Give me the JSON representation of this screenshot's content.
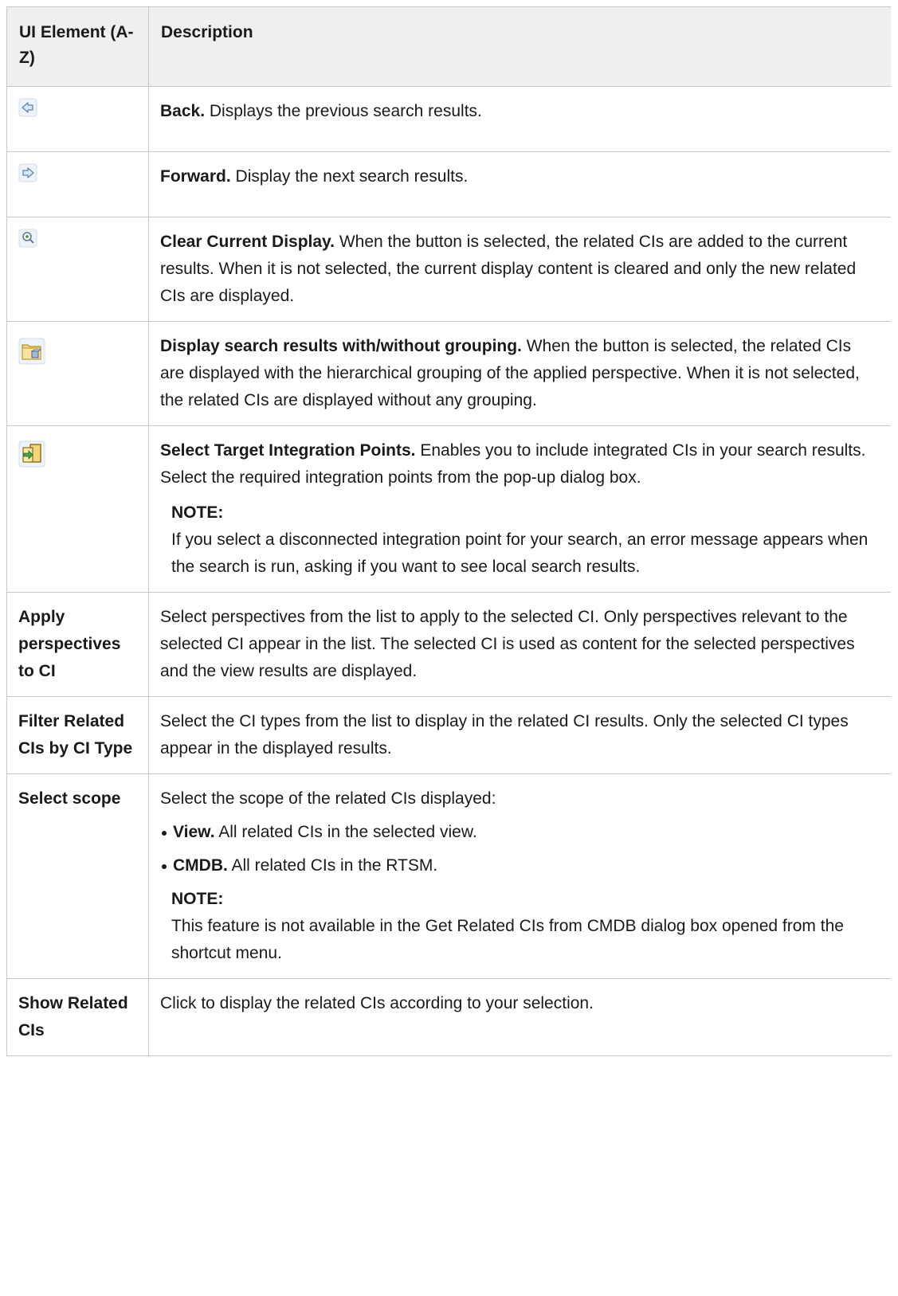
{
  "header": {
    "col_element": "UI Element (A-Z)",
    "col_description": "Description"
  },
  "rows": [
    {
      "icon": "back-arrow-icon",
      "lead": "Back.",
      "text": " Displays the previous search results."
    },
    {
      "icon": "forward-arrow-icon",
      "lead": "Forward.",
      "text": " Display the next search results."
    },
    {
      "icon": "clear-display-icon",
      "lead": "Clear Current Display.",
      "text": " When the button is selected, the related CIs are added to the current results. When it is not selected, the current display content is cleared and only the new related CIs are displayed."
    },
    {
      "icon": "grouping-folder-icon",
      "lead": "Display search results with/without grouping.",
      "text": " When the button is selected, the related CIs are displayed with the hierarchical grouping of the applied perspective. When it is not selected, the related CIs are displayed without any grouping."
    },
    {
      "icon": "integration-points-icon",
      "lead": "Select Target Integration Points.",
      "text": " Enables you to include integrated CIs in your search results. Select the required integration points from the pop-up dialog box.",
      "note_title": "NOTE:",
      "note_text": "If you select a disconnected integration point for your search, an error message appears when the search is run, asking if you want to see local search results."
    },
    {
      "element": "Apply perspectives to CI",
      "text": "Select perspectives from the list to apply to the selected CI. Only perspectives relevant to the selected CI appear in the list. The selected CI is used as content for the selected perspectives and the view results are displayed."
    },
    {
      "element": "Filter Related CIs by CI Type",
      "text": "Select the CI types from the list to display in the related CI results. Only the selected CI types appear in the displayed results."
    },
    {
      "element": "Select scope",
      "text": "Select the scope of the related CIs displayed:",
      "bullets": [
        {
          "lead": "View.",
          "text": " All related CIs in the selected view."
        },
        {
          "lead": "CMDB.",
          "text": " All related CIs in the RTSM."
        }
      ],
      "note_title": "NOTE:",
      "note_text": "This feature is not available in the Get Related CIs from CMDB dialog box opened from the shortcut menu."
    },
    {
      "element": "Show Related CIs",
      "text": "Click to display the related CIs according to your selection."
    }
  ],
  "colors": {
    "border": "#c8c8c8",
    "header_bg": "#efefef",
    "text": "#1a1a1a"
  }
}
